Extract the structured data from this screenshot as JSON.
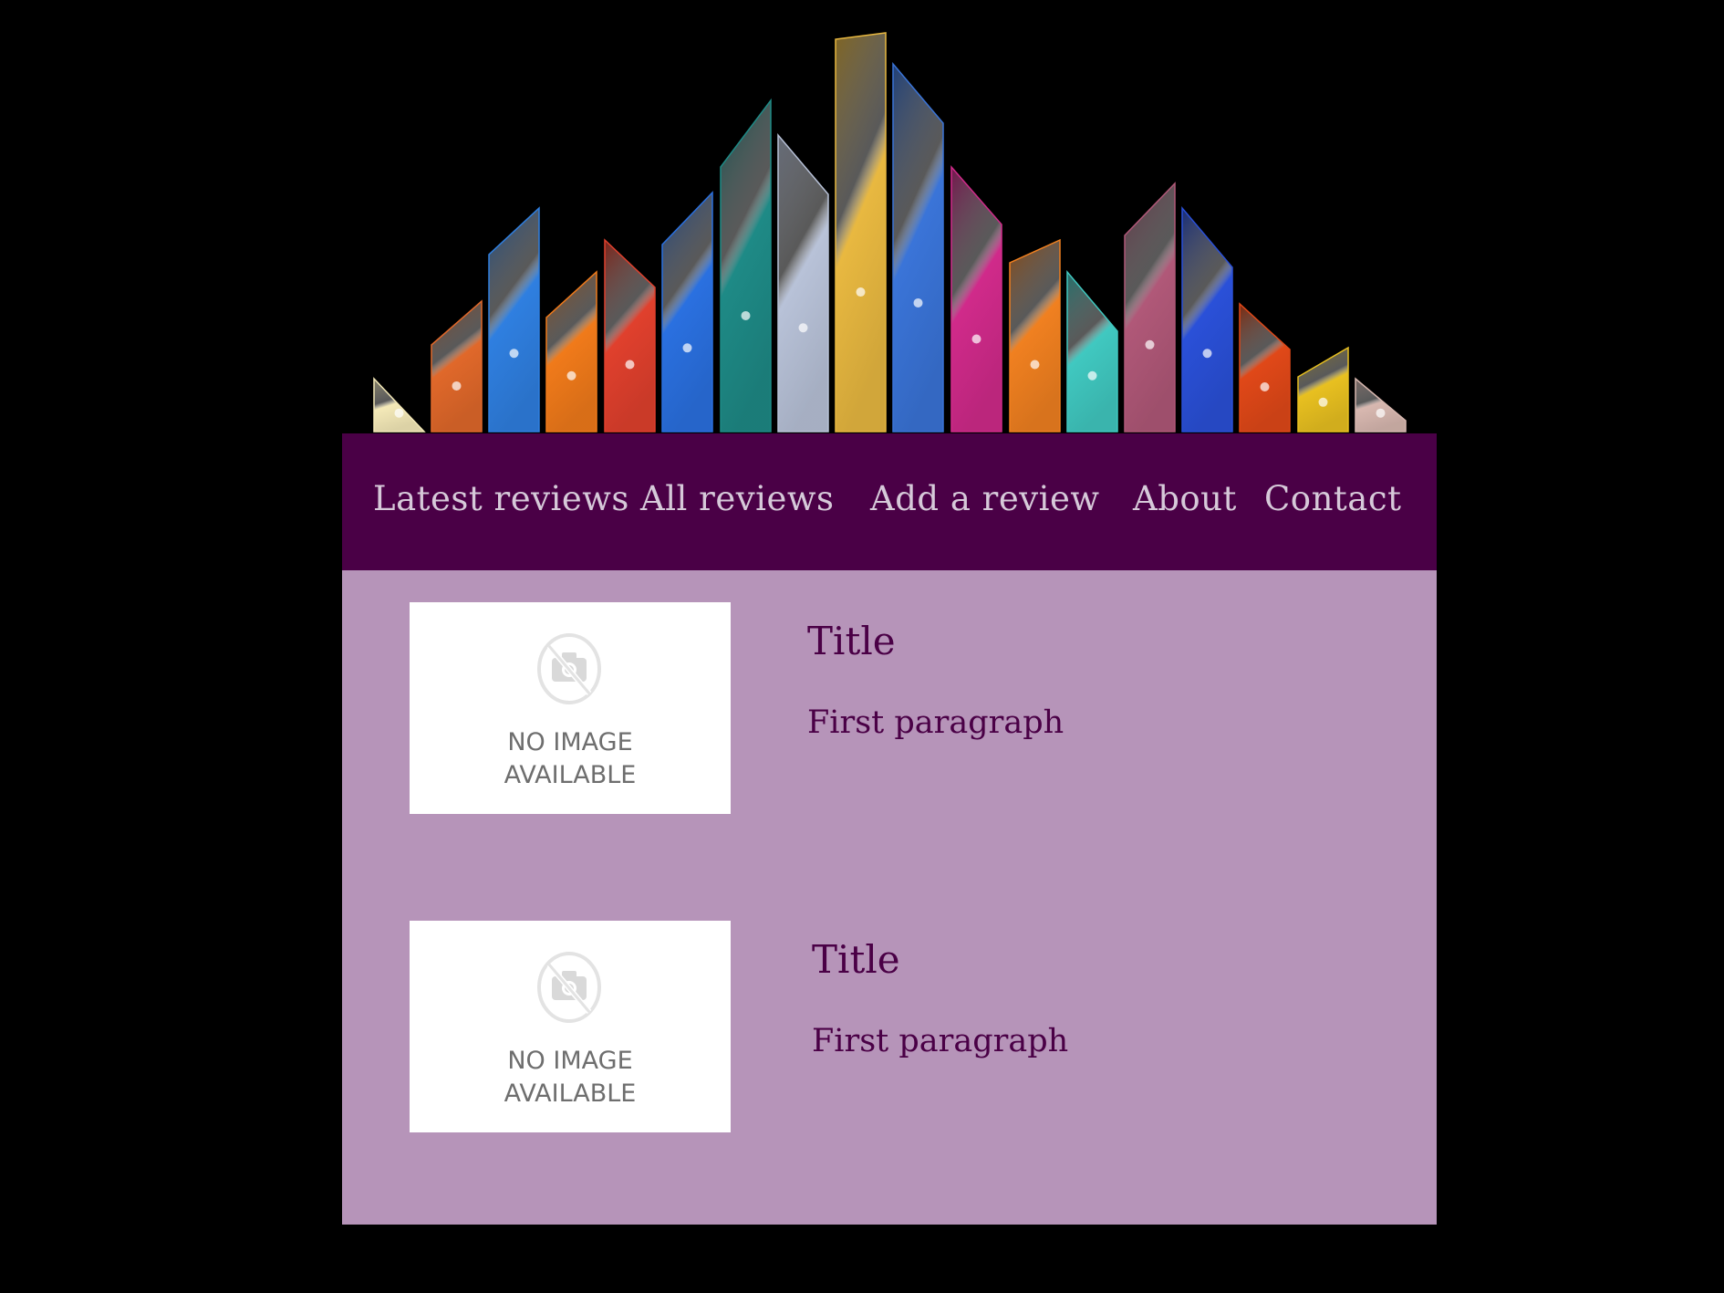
{
  "colors": {
    "page_background": "#000000",
    "nav_background": "#4a0046",
    "nav_text": "#d6c9d9",
    "content_background": "#b694b9",
    "heading_text": "#4a0046"
  },
  "banner": {
    "icon": "cosmic-crystals-banner",
    "crystal_colors": [
      "#f4e9b8",
      "#e0682a",
      "#2f7fe0",
      "#f07a1a",
      "#e0402d",
      "#2a70e0",
      "#1e8a86",
      "#b8c2d8",
      "#e8b840",
      "#3a74d8",
      "#d02a8a",
      "#f08020",
      "#40c8c0",
      "#b05878",
      "#2a50d8",
      "#e04818",
      "#e8c020",
      "#d8b8b0"
    ]
  },
  "nav": {
    "items": [
      {
        "label": "Latest reviews"
      },
      {
        "label": "All reviews"
      },
      {
        "label": "Add a review"
      },
      {
        "label": "About"
      },
      {
        "label": "Contact"
      }
    ]
  },
  "reviews": [
    {
      "image": {
        "line1": "NO IMAGE",
        "line2": "AVAILABLE",
        "icon": "no-camera-icon"
      },
      "title": "Title",
      "paragraph": "First paragraph"
    },
    {
      "image": {
        "line1": "NO IMAGE",
        "line2": "AVAILABLE",
        "icon": "no-camera-icon"
      },
      "title": "Title",
      "paragraph": "First paragraph"
    }
  ]
}
